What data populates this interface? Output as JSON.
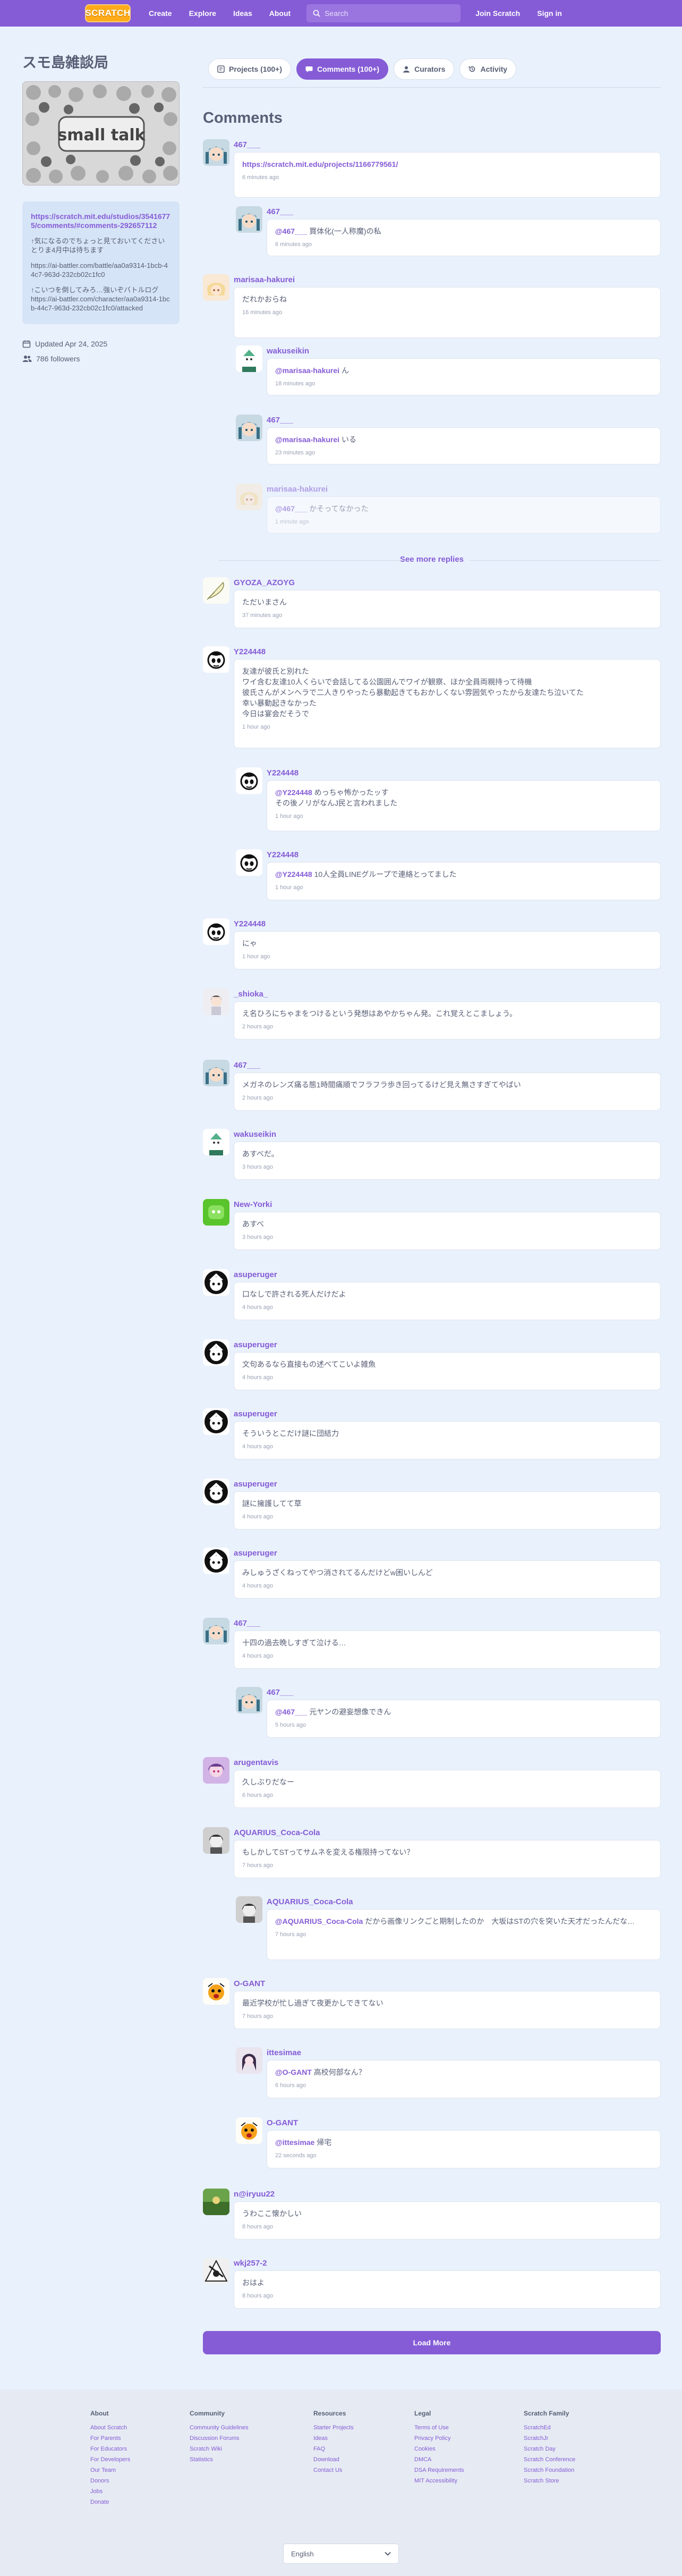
{
  "nav": {
    "logo": "SCRATCH",
    "links": [
      "Create",
      "Explore",
      "Ideas",
      "About"
    ],
    "search_placeholder": "Search",
    "join": "Join Scratch",
    "signin": "Sign in"
  },
  "studio": {
    "title": "スモ島雑談局",
    "thumb_text": "small talk",
    "desc_link": "https://scratch.mit.edu/studios/35416775/comments/#comments-292657112",
    "desc_p1": "↑気になるのでちょっと見ておいてください　とりま4月中は待ちます",
    "desc_p2": "https://ai-battler.com/battle/aa0a9314-1bcb-44c7-963d-232cb02c1fc0",
    "desc_p3": "↑こいつを倒してみろ…強いぞバトルログ\nhttps://ai-battler.com/character/aa0a9314-1bcb-44c7-963d-232cb02c1fc0/attacked",
    "updated": "Updated Apr 24, 2025",
    "followers": "786 followers"
  },
  "tabs": {
    "projects": "Projects (100+)",
    "comments": "Comments (100+)",
    "curators": "Curators",
    "activity": "Activity"
  },
  "comments_heading": "Comments",
  "see_more_replies": "See more replies",
  "load_more": "Load More",
  "comments": [
    {
      "user": "467___",
      "text": "https://scratch.mit.edu/projects/1166779561/",
      "time": "6 minutes ago",
      "kind": "link"
    },
    {
      "user": "467___",
      "mention": "@467___",
      "text": "買体化(一人称魔)の私",
      "time": "6 minutes ago"
    },
    {
      "user": "marisaa-hakurei",
      "text": "だれかおらね",
      "time": "16 minutes ago"
    },
    {
      "user": "wakuseikin",
      "mention": "@marisaa-hakurei",
      "text": "ん",
      "time": "18 minutes ago"
    },
    {
      "user": "467___",
      "mention": "@marisaa-hakurei",
      "text": "いる",
      "time": "23 minutes ago"
    },
    {
      "user": "marisaa-hakurei",
      "mention": "@467___",
      "text": "かそってなかった",
      "time": "1 minute ago"
    },
    {
      "user": "GYOZA_AZOYG",
      "text": "ただいまさん",
      "time": "37 minutes ago"
    },
    {
      "user": "Y224448",
      "text": "友達が彼氏と別れた\nワイ含む友達10人くらいで会話してる公園囲んでワイが観察、ほか全員両親持って待機\n彼氏さんがメンヘラで二人きりやったら暴動起きてもおかしくない雰囲気やったから友達たち泣いてた\n幸い暴動起きなかった\n今日は宴会だそうで",
      "time": "1 hour ago"
    },
    {
      "user": "Y224448",
      "mention": "@Y224448",
      "text": "めっちゃ怖かったッす\nその後ノリがなんJ民と言われました",
      "time": "1 hour ago"
    },
    {
      "user": "Y224448",
      "mention": "@Y224448",
      "text": "10人全員LINEグループで連絡とってました",
      "time": "1 hour ago"
    },
    {
      "user": "Y224448",
      "text": "にゃ",
      "time": "1 hour ago"
    },
    {
      "user": "_shioka_",
      "text": "え名ひろにちゃまをつけるという発想はあやかちゃん発。これ覚えとこましょう。",
      "time": "2 hours ago"
    },
    {
      "user": "467___",
      "text": "メガネのレンズ痛る態1時間痛順でフラフラ歩き回ってるけど見え無さすぎてやばい",
      "time": "2 hours ago"
    },
    {
      "user": "wakuseikin",
      "text": "あすべだ。",
      "time": "3 hours ago"
    },
    {
      "user": "New-Yorki",
      "text": "あすべ",
      "time": "3 hours ago"
    },
    {
      "user": "asuperuger",
      "text": "口なしで許される死人だけだよ",
      "time": "4 hours ago"
    },
    {
      "user": "asuperuger",
      "text": "文句あるなら直接もの述べてこいよ雑魚",
      "time": "4 hours ago"
    },
    {
      "user": "asuperuger",
      "text": "そういうとこだけ謎に団結力",
      "time": "4 hours ago"
    },
    {
      "user": "asuperuger",
      "text": "謎に擁護してて草",
      "time": "4 hours ago"
    },
    {
      "user": "asuperuger",
      "text": "みしゅうざくねってやつ消されてるんだけどw困いしんど",
      "time": "4 hours ago"
    },
    {
      "user": "467___",
      "text": "十四の過去晩しすぎて泣ける…",
      "time": "4 hours ago"
    },
    {
      "user": "467___",
      "mention": "@467___",
      "text": "元ヤンの避妄想像できん",
      "time": "5 hours ago"
    },
    {
      "user": "arugentavis",
      "text": "久しぶりだなー",
      "time": "6 hours ago"
    },
    {
      "user": "AQUARIUS_Coca-Cola",
      "text": "もしかしてSTってサムネを変える権限持ってない？",
      "time": "7 hours ago"
    },
    {
      "user": "AQUARIUS_Coca-Cola",
      "mention": "@AQUARIUS_Coca-Cola",
      "text": "だから画像リンクごと期制したのか　大坂はSTの穴を突いた天才だったんだな…",
      "time": "7 hours ago"
    },
    {
      "user": "O-GANT",
      "text": "最近学校が忙し過ぎて夜更かしできてない",
      "time": "7 hours ago"
    },
    {
      "user": "ittesimae",
      "mention": "@O-GANT",
      "text": "高校何部なん？",
      "time": "6 hours ago"
    },
    {
      "user": "O-GANT",
      "mention": "@ittesimae",
      "text": "帰宅",
      "time": "22 seconds ago"
    },
    {
      "user": "n@iryuu22",
      "text": "うわここ懐かしい",
      "time": "8 hours ago"
    },
    {
      "user": "wkj257-2",
      "text": "おはよ",
      "time": "8 hours ago"
    }
  ],
  "footer": {
    "cols": [
      {
        "title": "About",
        "links": [
          "About Scratch",
          "For Parents",
          "For Educators",
          "For Developers",
          "Our Team",
          "Donors",
          "Jobs",
          "Donate"
        ]
      },
      {
        "title": "Community",
        "links": [
          "Community Guidelines",
          "Discussion Forums",
          "Scratch Wiki",
          "Statistics"
        ]
      },
      {
        "title": "Resources",
        "links": [
          "Starter Projects",
          "Ideas",
          "FAQ",
          "Download",
          "Contact Us"
        ]
      },
      {
        "title": "Legal",
        "links": [
          "Terms of Use",
          "Privacy Policy",
          "Cookies",
          "DMCA",
          "DSA Requirements",
          "MIT Accessibility"
        ]
      },
      {
        "title": "Scratch Family",
        "links": [
          "ScratchEd",
          "ScratchJr",
          "Scratch Day",
          "Scratch Conference",
          "Scratch Foundation",
          "Scratch Store"
        ]
      }
    ],
    "language": "English"
  },
  "colors": {
    "brand": "#855cd6",
    "logo": "#ffab19",
    "bg": "#e9f1fc"
  }
}
